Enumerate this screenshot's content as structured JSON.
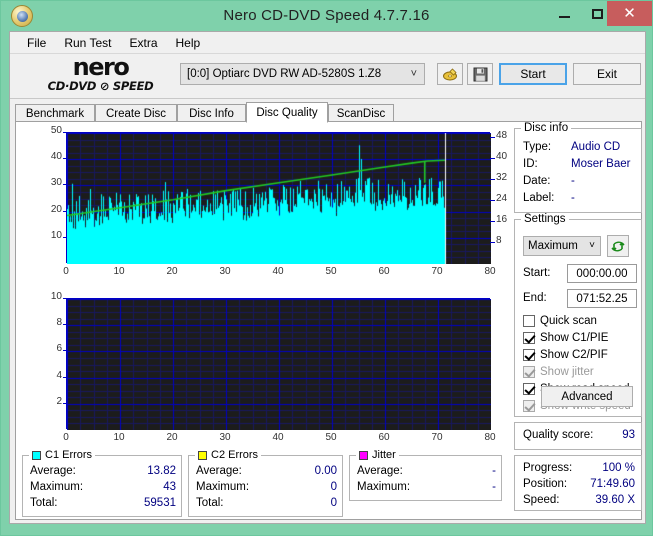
{
  "window": {
    "title": "Nero CD-DVD Speed 4.7.7.16",
    "icon": "disc-icon",
    "controls": {
      "minimize": "–",
      "maximize": "❐",
      "close": "✕"
    },
    "titlebar_color": "#7fd1ab",
    "close_color": "#c75d5d"
  },
  "menu": {
    "items": [
      "File",
      "Run Test",
      "Extra",
      "Help"
    ]
  },
  "toolbar": {
    "logo_main": "nero",
    "logo_sub": "CD·DVD ⊘ SPEED",
    "drive": "[0:0]   Optiarc DVD RW AD-5280S 1.Z8",
    "dropdown_arrow": "˅",
    "eject_icon": "eject-disc-icon",
    "save_icon": "floppy-save-icon",
    "start_label": "Start",
    "exit_label": "Exit"
  },
  "tabs": {
    "items": [
      "Benchmark",
      "Create Disc",
      "Disc Info",
      "Disc Quality",
      "ScanDisc"
    ],
    "active": "Disc Quality"
  },
  "disc_info": {
    "title": "Disc info",
    "rows": [
      {
        "key": "Type:",
        "value": "Audio CD"
      },
      {
        "key": "ID:",
        "value": "Moser Baer"
      },
      {
        "key": "Date:",
        "value": "-"
      },
      {
        "key": "Label:",
        "value": "-"
      }
    ]
  },
  "settings": {
    "title": "Settings",
    "speed": "Maximum",
    "speed_arrow": "˅",
    "refresh_icon": "refresh-speed-icon",
    "start_label": "Start:",
    "start_value": "000:00.00",
    "end_label": "End:",
    "end_value": "071:52.25",
    "checkboxes": [
      {
        "label": "Quick scan",
        "checked": false,
        "disabled": false
      },
      {
        "label": "Show C1/PIE",
        "checked": true,
        "disabled": false
      },
      {
        "label": "Show C2/PIF",
        "checked": true,
        "disabled": false
      },
      {
        "label": "Show jitter",
        "checked": true,
        "disabled": true
      },
      {
        "label": "Show read speed",
        "checked": true,
        "disabled": false
      },
      {
        "label": "Show write speed",
        "checked": true,
        "disabled": true
      }
    ],
    "advanced_label": "Advanced"
  },
  "quality": {
    "label": "Quality score:",
    "value": "93"
  },
  "progress": {
    "rows": [
      {
        "key": "Progress:",
        "value": "100 %"
      },
      {
        "key": "Position:",
        "value": "71:49.60"
      },
      {
        "key": "Speed:",
        "value": "39.60 X"
      }
    ]
  },
  "stats": [
    {
      "title": "C1 Errors",
      "color": "#00ffff",
      "rows": [
        {
          "key": "Average:",
          "value": "13.82"
        },
        {
          "key": "Maximum:",
          "value": "43"
        },
        {
          "key": "Total:",
          "value": "59531"
        }
      ]
    },
    {
      "title": "C2 Errors",
      "color": "#ffff00",
      "rows": [
        {
          "key": "Average:",
          "value": "0.00"
        },
        {
          "key": "Maximum:",
          "value": "0"
        },
        {
          "key": "Total:",
          "value": "0"
        }
      ]
    },
    {
      "title": "Jitter",
      "color": "#ff00ff",
      "rows": [
        {
          "key": "Average:",
          "value": "-"
        },
        {
          "key": "Maximum:",
          "value": "-"
        }
      ]
    }
  ],
  "chart_data": [
    {
      "type": "area",
      "name": "C1 Errors vs position",
      "title": "",
      "xlabel": "",
      "ylabel": "",
      "xlim": [
        0,
        80
      ],
      "ylim": [
        0,
        50
      ],
      "y2lim": [
        0,
        50
      ],
      "xticks": [
        0,
        10,
        20,
        30,
        40,
        50,
        60,
        70,
        80
      ],
      "yticks": [
        10,
        20,
        30,
        40,
        50
      ],
      "y2ticks": [
        8,
        16,
        24,
        32,
        40,
        48
      ],
      "grid": true,
      "plot_bg": "#1c1c1c",
      "grid_color": "#0000c8",
      "series": [
        {
          "name": "C1 Errors",
          "color": "#00ffff",
          "type": "area",
          "data_end_x": 71.3,
          "baseline": [
            18,
            18,
            19,
            19,
            19,
            20,
            20,
            20,
            20,
            20,
            20,
            20,
            20,
            20,
            20,
            20,
            21,
            21,
            21,
            21,
            21,
            22,
            22,
            22,
            22,
            22,
            22,
            22,
            22,
            22,
            22,
            23,
            23,
            23,
            23,
            23,
            23,
            24,
            24,
            24,
            24,
            24,
            24,
            24,
            25,
            25,
            25,
            25,
            25,
            25,
            25,
            25,
            26,
            26,
            26,
            26,
            26,
            26,
            26,
            26,
            26,
            26,
            26,
            26,
            26,
            26,
            26,
            26,
            26,
            26,
            26,
            26
          ],
          "values": [
            14,
            27,
            20,
            17,
            23,
            19,
            30,
            22,
            18,
            26,
            21,
            16,
            29,
            24,
            19,
            22,
            27,
            18,
            24,
            20,
            31,
            17,
            25,
            22,
            19,
            28,
            23,
            18,
            26,
            21,
            15,
            32,
            24,
            20,
            27,
            18,
            23,
            29,
            21,
            17,
            25,
            22,
            28,
            19,
            24,
            20,
            30,
            26,
            22,
            18,
            43,
            25,
            21,
            27,
            36,
            23,
            19,
            29,
            24,
            20,
            26,
            22,
            31,
            18,
            25,
            12,
            28,
            23,
            19,
            35,
            26,
            22,
            30,
            24,
            20,
            27,
            33,
            40,
            29,
            23,
            26,
            21,
            35,
            27,
            24,
            30,
            22,
            28,
            25,
            33,
            26,
            21,
            29,
            24,
            31,
            27,
            23,
            25,
            30,
            26
          ],
          "max": 43,
          "average": 13.82,
          "total": 59531
        },
        {
          "name": "Read speed",
          "color": "#22cc22",
          "type": "line",
          "axis": "right",
          "x": [
            0,
            10,
            20,
            30,
            40,
            50,
            60,
            65,
            68,
            71.3
          ],
          "y": [
            18.5,
            21.5,
            24.5,
            28,
            31,
            34,
            37,
            38.5,
            39.3,
            39.6
          ],
          "final_value": 39.6
        }
      ],
      "cursor_x": 71.3,
      "cursor_color": "#ffffff"
    },
    {
      "type": "area",
      "name": "C2 Errors vs position",
      "title": "",
      "xlabel": "",
      "ylabel": "",
      "xlim": [
        0,
        80
      ],
      "ylim": [
        0,
        10
      ],
      "xticks": [
        0,
        10,
        20,
        30,
        40,
        50,
        60,
        70,
        80
      ],
      "yticks": [
        2,
        4,
        6,
        8,
        10
      ],
      "grid": true,
      "plot_bg": "#1c1c1c",
      "grid_color": "#0000c8",
      "series": [
        {
          "name": "C2 Errors",
          "color": "#ffff00",
          "type": "area",
          "values": [],
          "max": 0,
          "average": 0.0,
          "total": 0
        }
      ]
    }
  ]
}
